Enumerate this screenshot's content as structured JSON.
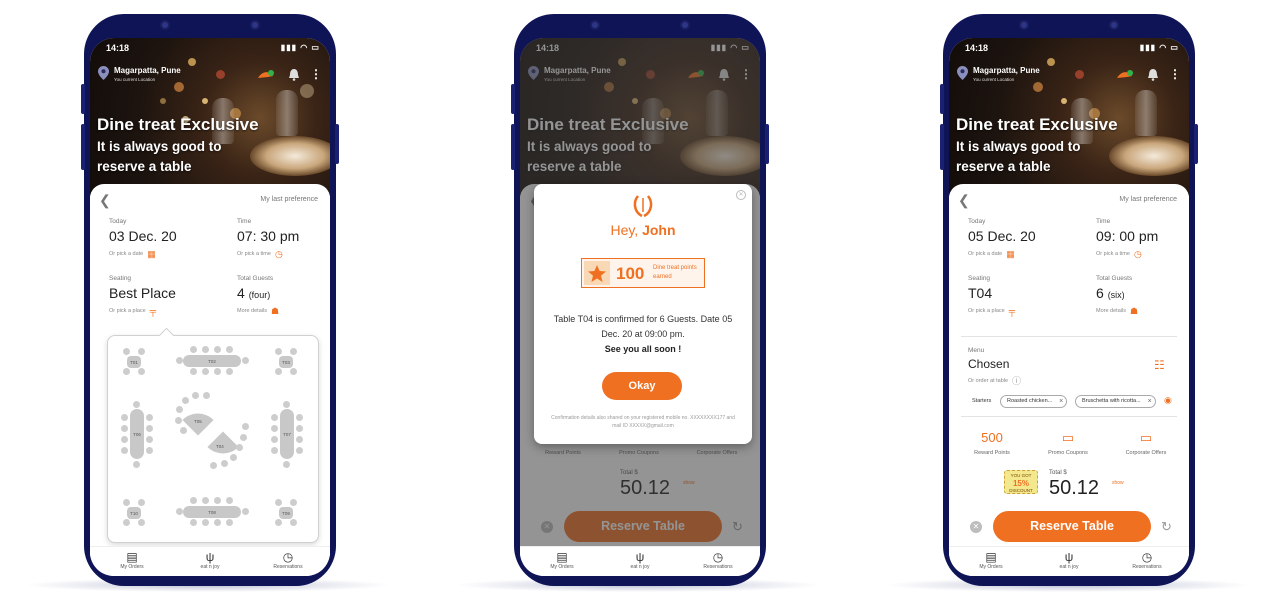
{
  "brand": {
    "accent": "#f07022",
    "frame": "#0f1457"
  },
  "status": {
    "time": "14:18",
    "icons": "▮▮▮ ◠ ▭"
  },
  "location": {
    "city": "Magarpatta, Pune",
    "sub": "You current Location"
  },
  "hero": {
    "title": "Dine treat Exclusive",
    "subtitle": "It is always good to reserve a table"
  },
  "common": {
    "last_pref": "My last preference",
    "today_label": "Today",
    "time_label": "Time",
    "seating_label": "Seating",
    "guests_label": "Total Guests",
    "pick_date": "Or pick a date",
    "pick_time": "Or pick a time",
    "pick_place": "Or pick a place",
    "more_details": "More details"
  },
  "phone1": {
    "date": "03 Dec. 20",
    "time": "07: 30 pm",
    "seating": "Best Place",
    "guests": "4",
    "guests_word": "(four)",
    "tables": [
      "T01",
      "T02",
      "T03",
      "T05",
      "T04",
      "T06",
      "T07",
      "T10",
      "T08",
      "T09"
    ]
  },
  "phone2": {
    "greeting": "Hey,",
    "name": "John",
    "points": "100",
    "points_label": "Dine treat points earned",
    "confirm": "Table T04 is confirmed for 6 Guests. Date 05 Dec. 20 at 09:00 pm.",
    "see_you": "See you all soon !",
    "ok": "Okay",
    "note": "Confirmation details also shared on your registered mobile no. XXXXXXXX177 and mail ID XXXXX@gmail.com"
  },
  "phone3": {
    "date": "05 Dec. 20",
    "time": "09: 00 pm",
    "seating": "T04",
    "guests": "6",
    "guests_word": "(six)",
    "menu_label": "Menu",
    "menu_value": "Chosen",
    "order_at_table": "Or order at table",
    "starters_label": "Starters",
    "starter_1": "Roasted chicken...",
    "starter_2": "Bruschetta with ricotta...",
    "reward_points_value": "500",
    "discount_top": "YOU GOT",
    "discount_pct": "15%",
    "discount_bottom": "DISCOUNT"
  },
  "rewards": {
    "points": "Reward Points",
    "promo": "Promo Coupons",
    "corp": "Corporate Offers"
  },
  "total": {
    "label": "Total $",
    "amount": "50.12",
    "tag": "show"
  },
  "reserve": {
    "label": "Reserve Table"
  },
  "nav": {
    "orders": "My Orders",
    "eat": "eat n joy",
    "reservations": "Reservations"
  }
}
